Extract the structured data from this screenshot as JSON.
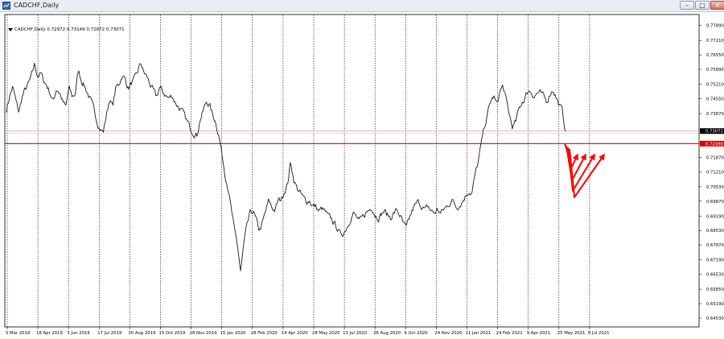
{
  "window": {
    "title": "CADCHF,Daily",
    "buttons": [
      "minimize",
      "restore",
      "close"
    ]
  },
  "info_line": {
    "symbol": "CADCHF,Daily",
    "values": "0.72972 0.73149 0.72872 0.73071"
  },
  "colors": {
    "background": "#ffffff",
    "price_line": "#000000",
    "grid": "#000000",
    "support_line": "#e00000",
    "current_price_line": "#c0c0c0",
    "current_label_bg": "#000000",
    "support_label_bg": "#e00000",
    "arrows": "#ff0000"
  },
  "chart_data": {
    "type": "line",
    "title": "CADCHF,Daily",
    "ylim": [
      0.6453,
      0.7821
    ],
    "y_ticks": [
      "0.77890",
      "0.77210",
      "0.76550",
      "0.75890",
      "0.75210",
      "0.74550",
      "0.73870",
      "0.73071",
      "0.72498",
      "0.71870",
      "0.71210",
      "0.70530",
      "0.69870",
      "0.69190",
      "0.68530",
      "0.67870",
      "0.67190",
      "0.66530",
      "0.65850",
      "0.65190",
      "0.64530"
    ],
    "x_ticks": [
      "5 Mar 2019",
      "18 Apr 2019",
      "3 Jun 2019",
      "17 Jul 2019",
      "30 Aug 2019",
      "15 Oct 2019",
      "28 Nov 2019",
      "15 Jan 2020",
      "28 Feb 2020",
      "14 Apr 2020",
      "28 May 2020",
      "13 Jul 2020",
      "26 Aug 2020",
      "9 Oct 2020",
      "24 Nov 2020",
      "11 Jan 2021",
      "24 Feb 2021",
      "9 Apr 2021",
      "25 May 2021",
      "8 Jul 2021"
    ],
    "current_price": "0.73071",
    "support_level": "0.72498",
    "series": [
      {
        "values": [
          0.7405,
          0.7465,
          0.7508,
          0.7445,
          0.7392,
          0.7462,
          0.7495,
          0.752,
          0.7555,
          0.7612,
          0.756,
          0.757,
          0.7535,
          0.7515,
          0.748,
          0.744,
          0.7502,
          0.7485,
          0.7442,
          0.7415,
          0.7502,
          0.7465,
          0.7475,
          0.7585,
          0.754,
          0.7515,
          0.748,
          0.7445,
          0.7402,
          0.7355,
          0.7318,
          0.7302,
          0.738,
          0.7452,
          0.742,
          0.7502,
          0.7522,
          0.756,
          0.7545,
          0.7502,
          0.7525,
          0.754,
          0.7575,
          0.762,
          0.7572,
          0.7555,
          0.752,
          0.749,
          0.746,
          0.7505,
          0.7488,
          0.747,
          0.7455,
          0.7472,
          0.744,
          0.742,
          0.7402,
          0.7375,
          0.7345,
          0.7318,
          0.7302,
          0.7288,
          0.736,
          0.7398,
          0.744,
          0.7428,
          0.738,
          0.7352,
          0.7288,
          0.7202,
          0.7112,
          0.7048,
          0.6945,
          0.6852,
          0.6782,
          0.6662,
          0.679,
          0.687,
          0.6928,
          0.6942,
          0.6895,
          0.6852,
          0.6888,
          0.6938,
          0.6988,
          0.6958,
          0.6945,
          0.6988,
          0.6995,
          0.7035,
          0.7065,
          0.7165,
          0.7085,
          0.7048,
          0.7025,
          0.7002,
          0.6985,
          0.6992,
          0.6968,
          0.6962,
          0.694,
          0.6952,
          0.6938,
          0.6915,
          0.6905,
          0.6885,
          0.6862,
          0.6832,
          0.6845,
          0.687,
          0.6905,
          0.6932,
          0.6915,
          0.6892,
          0.691,
          0.6932,
          0.6945,
          0.6962,
          0.6928,
          0.6912,
          0.6928,
          0.6942,
          0.6922,
          0.6912,
          0.6932,
          0.6945,
          0.6922,
          0.6885,
          0.6858,
          0.6905,
          0.6945,
          0.6968,
          0.6985,
          0.6965,
          0.6945,
          0.6962,
          0.6942,
          0.6932,
          0.6948,
          0.6932,
          0.6948,
          0.6962,
          0.6982,
          0.6988,
          0.6965,
          0.6968,
          0.6988,
          0.7012,
          0.7035,
          0.7022,
          0.7102,
          0.7162,
          0.7245,
          0.7325,
          0.7382,
          0.7442,
          0.7465,
          0.7425,
          0.7488,
          0.7512,
          0.7445,
          0.7382,
          0.7325,
          0.7345,
          0.7402,
          0.7438,
          0.7458,
          0.7492,
          0.7488,
          0.7465,
          0.7482,
          0.7478,
          0.7462,
          0.7442,
          0.7478,
          0.7498,
          0.7462,
          0.7425,
          0.7398,
          0.7307
        ]
      }
    ],
    "annotation": "arrows"
  }
}
